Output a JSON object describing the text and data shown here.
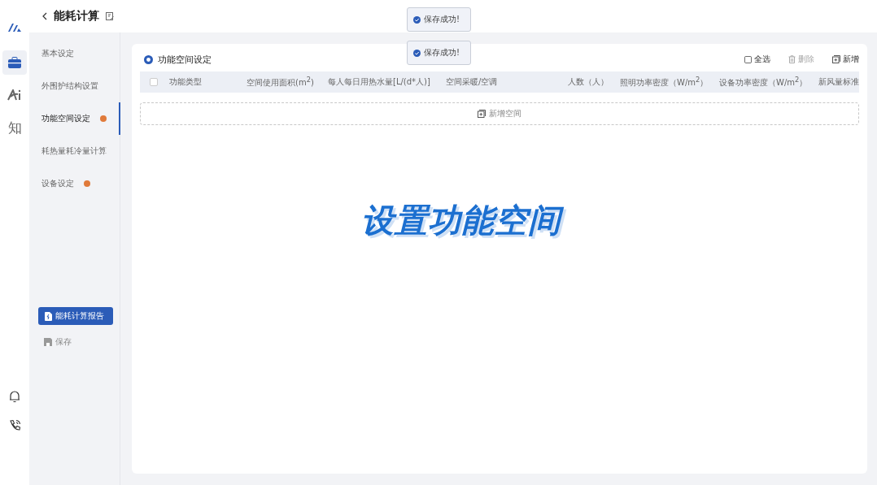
{
  "header": {
    "title": "能耗计算"
  },
  "rail": {
    "items": [
      {
        "kind": "briefcase",
        "selected": true
      },
      {
        "kind": "ai",
        "selected": false
      },
      {
        "kind": "glyph",
        "label": "知",
        "selected": false
      }
    ]
  },
  "sidebar": {
    "items": [
      {
        "label": "基本设定",
        "selected": false,
        "warning": false
      },
      {
        "label": "外围护结构设置",
        "selected": false,
        "warning": false
      },
      {
        "label": "功能空间设定",
        "selected": true,
        "warning": true
      },
      {
        "label": "耗热量耗冷量计算",
        "selected": false,
        "warning": false
      },
      {
        "label": "设备设定",
        "selected": false,
        "warning": true
      }
    ],
    "report_button": "能耗计算报告",
    "save_button": "保存"
  },
  "toasts": [
    "保存成功!",
    "保存成功!"
  ],
  "panel": {
    "title": "功能空间设定",
    "actions": [
      {
        "kind": "select-all",
        "label": "全选",
        "disabled": false
      },
      {
        "kind": "delete",
        "label": "删除",
        "disabled": true
      },
      {
        "kind": "add",
        "label": "新增",
        "disabled": false
      }
    ],
    "table": {
      "header_checked": false,
      "columns": [
        "功能类型",
        "空间使用面积(m$^{2}$)",
        "每人每日用热水量[L/(d*人)]",
        "空间采暖/空调",
        "人数（人）",
        "照明功率密度（W/m$^{2}$）",
        "设备功率密度（W/m$^{2}$）",
        "新风量标准"
      ]
    },
    "add_row": "新增空间"
  },
  "caption": "设置功能空间"
}
